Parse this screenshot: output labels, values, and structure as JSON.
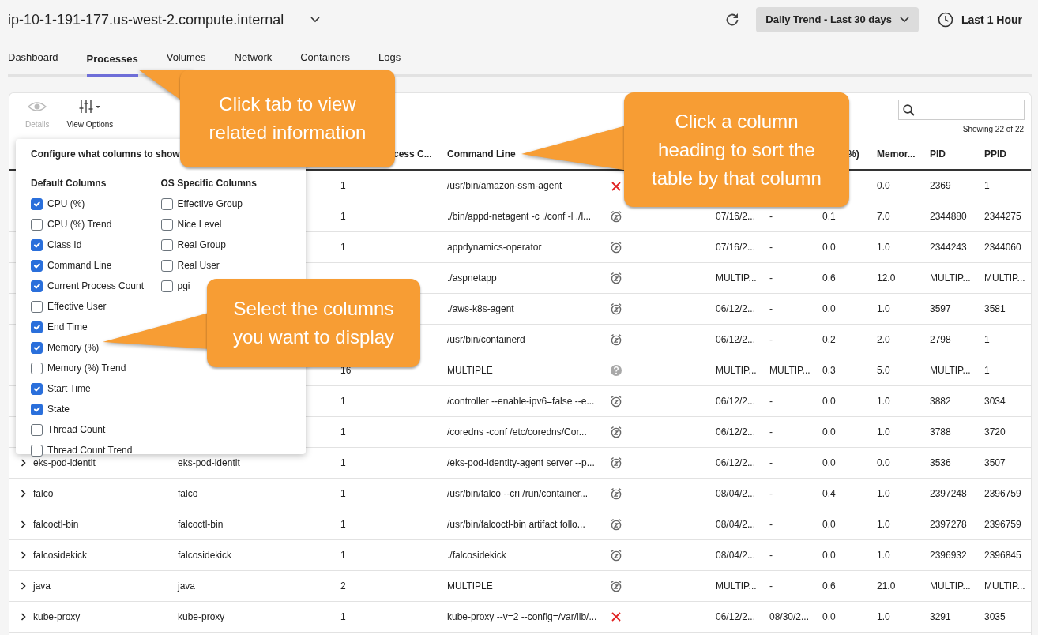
{
  "header": {
    "host": "ip-10-1-191-177.us-west-2.compute.internal",
    "trend_button": "Daily Trend - Last 30 days",
    "time_range": "Last 1 Hour"
  },
  "tabs": [
    {
      "label": "Dashboard",
      "selected": false
    },
    {
      "label": "Processes",
      "selected": true
    },
    {
      "label": "Volumes",
      "selected": false
    },
    {
      "label": "Network",
      "selected": false
    },
    {
      "label": "Containers",
      "selected": false
    },
    {
      "label": "Logs",
      "selected": false
    }
  ],
  "toolbar": {
    "buttons": [
      {
        "kind": "details",
        "label": "Details",
        "disabled": true
      },
      {
        "kind": "view-options",
        "label": "View Options",
        "disabled": false
      }
    ],
    "count": "Showing 22 of 22"
  },
  "table": {
    "headers": {
      "count": "cess C...",
      "command": "Command Line",
      "cpu": "%)",
      "memory": "Memor...",
      "pid": "PID",
      "ppid": "PPID"
    },
    "rows": [
      {
        "count": "1",
        "command": "/usr/bin/amazon-ssm-agent",
        "state": {
          "kind": "stopped"
        },
        "memory": "0.0",
        "pid": "2369",
        "ppid": "1"
      },
      {
        "count": "1",
        "command": "./bin/appd-netagent -c ./conf -l ./l...",
        "state": {
          "kind": "sleeping"
        },
        "start": "07/16/2...",
        "end": "-",
        "cpu": "0.1",
        "memory": "7.0",
        "pid": "2344880",
        "ppid": "2344275"
      },
      {
        "count": "1",
        "command": "appdynamics-operator",
        "state": {
          "kind": "sleeping"
        },
        "start": "07/16/2...",
        "end": "-",
        "cpu": "0.0",
        "memory": "1.0",
        "pid": "2344243",
        "ppid": "2344060"
      },
      {
        "command": "./aspnetapp",
        "state": {
          "kind": "sleeping"
        },
        "start": "MULTIP...",
        "end": "-",
        "cpu": "0.6",
        "memory": "12.0",
        "pid": "MULTIP...",
        "ppid": "MULTIP..."
      },
      {
        "command": "./aws-k8s-agent",
        "state": {
          "kind": "sleeping"
        },
        "start": "06/12/2...",
        "end": "-",
        "cpu": "0.0",
        "memory": "1.0",
        "pid": "3597",
        "ppid": "3581"
      },
      {
        "command": "/usr/bin/containerd",
        "state": {
          "kind": "sleeping"
        },
        "start": "06/12/2...",
        "end": "-",
        "cpu": "0.2",
        "memory": "2.0",
        "pid": "2798",
        "ppid": "1"
      },
      {
        "count": "16",
        "command": "MULTIPLE",
        "state": {
          "kind": "unknown"
        },
        "start": "MULTIP...",
        "end": "MULTIP...",
        "cpu": "0.3",
        "memory": "5.0",
        "pid": "MULTIP...",
        "ppid": "1"
      },
      {
        "count": "1",
        "command": "/controller --enable-ipv6=false --e...",
        "state": {
          "kind": "sleeping"
        },
        "start": "06/12/2...",
        "end": "-",
        "cpu": "0.0",
        "memory": "1.0",
        "pid": "3882",
        "ppid": "3034"
      },
      {
        "count": "1",
        "command": "/coredns -conf /etc/coredns/Cor...",
        "state": {
          "kind": "sleeping"
        },
        "start": "06/12/2...",
        "end": "-",
        "cpu": "0.0",
        "memory": "1.0",
        "pid": "3788",
        "ppid": "3720"
      },
      {
        "name": "eks-pod-identit",
        "class_id": "eks-pod-identit",
        "count": "1",
        "command": "/eks-pod-identity-agent server --p...",
        "state": {
          "kind": "sleeping"
        },
        "start": "06/12/2...",
        "end": "-",
        "cpu": "0.0",
        "memory": "0.0",
        "pid": "3536",
        "ppid": "3507"
      },
      {
        "name": "falco",
        "class_id": "falco",
        "count": "1",
        "command": "/usr/bin/falco --cri /run/container...",
        "state": {
          "kind": "sleeping"
        },
        "start": "08/04/2...",
        "end": "-",
        "cpu": "0.4",
        "memory": "1.0",
        "pid": "2397248",
        "ppid": "2396759"
      },
      {
        "name": "falcoctl-bin",
        "class_id": "falcoctl-bin",
        "count": "1",
        "command": "/usr/bin/falcoctl-bin artifact follo...",
        "state": {
          "kind": "sleeping"
        },
        "start": "08/04/2...",
        "end": "-",
        "cpu": "0.0",
        "memory": "1.0",
        "pid": "2397278",
        "ppid": "2396759"
      },
      {
        "name": "falcosidekick",
        "class_id": "falcosidekick",
        "count": "1",
        "command": "./falcosidekick",
        "state": {
          "kind": "sleeping"
        },
        "start": "08/04/2...",
        "end": "-",
        "cpu": "0.0",
        "memory": "1.0",
        "pid": "2396932",
        "ppid": "2396845"
      },
      {
        "name": "java",
        "class_id": "java",
        "count": "2",
        "command": "MULTIPLE",
        "state": {
          "kind": "sleeping"
        },
        "start": "MULTIP...",
        "end": "-",
        "cpu": "0.6",
        "memory": "21.0",
        "pid": "MULTIP...",
        "ppid": "MULTIP..."
      },
      {
        "name": "kube-proxy",
        "class_id": "kube-proxy",
        "count": "1",
        "command": "kube-proxy --v=2 --config=/var/lib/...",
        "state": {
          "kind": "stopped"
        },
        "start": "06/12/2...",
        "end": "08/30/2...",
        "cpu": "0.0",
        "memory": "1.0",
        "pid": "3291",
        "ppid": "3035"
      }
    ]
  },
  "column_menu": {
    "title": "Configure what columns to show",
    "groups": [
      {
        "heading": "Default Columns",
        "items": [
          {
            "label": "CPU (%)",
            "checked": true
          },
          {
            "label": "CPU (%) Trend",
            "checked": false
          },
          {
            "label": "Class Id",
            "checked": true
          },
          {
            "label": "Command Line",
            "checked": true
          },
          {
            "label": "Current Process Count",
            "checked": true
          },
          {
            "label": "Effective User",
            "checked": false
          },
          {
            "label": "End Time",
            "checked": true
          },
          {
            "label": "Memory (%)",
            "checked": true
          },
          {
            "label": "Memory (%) Trend",
            "checked": false
          },
          {
            "label": "Start Time",
            "checked": true
          },
          {
            "label": "State",
            "checked": true
          },
          {
            "label": "Thread Count",
            "checked": false
          },
          {
            "label": "Thread Count Trend",
            "checked": false
          }
        ]
      },
      {
        "heading": "OS Specific Columns",
        "items": [
          {
            "label": "Effective Group",
            "checked": false
          },
          {
            "label": "Nice Level",
            "checked": false
          },
          {
            "label": "Real Group",
            "checked": false
          },
          {
            "label": "Real User",
            "checked": false
          },
          {
            "label": "pgi",
            "checked": false
          }
        ]
      }
    ]
  },
  "callouts": [
    {
      "text": "Click tab to view\nrelated information"
    },
    {
      "text": "Click a column\nheading to sort the\ntable by that column"
    },
    {
      "text": "Select the columns\nyou want to display"
    }
  ]
}
